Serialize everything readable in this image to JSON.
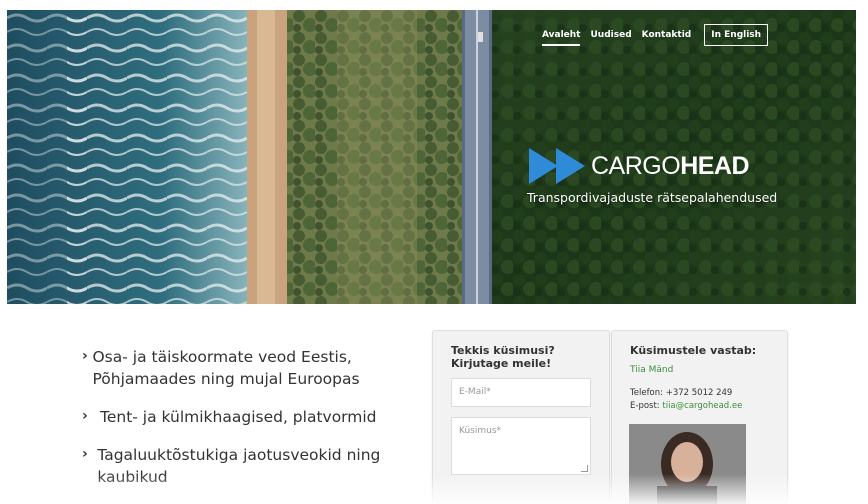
{
  "nav": {
    "items": [
      {
        "label": "Avaleht",
        "active": true
      },
      {
        "label": "Uudised",
        "active": false
      },
      {
        "label": "Kontaktid",
        "active": false
      }
    ],
    "english_label": "In English"
  },
  "brand": {
    "name_light": "CARGO",
    "name_bold": "HEAD",
    "tagline": "Transpordivajaduste rätsepalahendused",
    "logo_color": "#2f8ad8"
  },
  "benefits": [
    "Osa- ja täiskoormate veod Eestis, Põhjamaades ning mujal Euroopas",
    "Tent- ja külmikhaagised, platvormid",
    "Tagaluuktõstukiga jaotusveokid ning kaubikud"
  ],
  "form": {
    "title": "Tekkis küsimusi? Kirjutage meile!",
    "email_placeholder": "E-Mail*",
    "question_placeholder": "Küsimus*"
  },
  "contact": {
    "title": "Küsimustele vastab:",
    "name": "Tiia Mänd",
    "phone_label": "Telefon:",
    "phone": "+372 5012 249",
    "email_label": "E-post:",
    "email": "tiia@cargohead.ee"
  },
  "colors": {
    "accent_green": "#3a8f3a",
    "hero_forest": "#1f3a22"
  }
}
